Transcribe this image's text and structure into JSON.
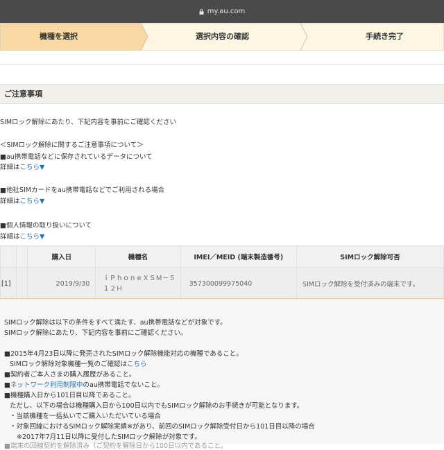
{
  "browser": {
    "url": "my.au.com"
  },
  "steps": {
    "items": [
      {
        "label": "機種を選択",
        "active": true
      },
      {
        "label": "選択内容の確認",
        "active": false
      },
      {
        "label": "手続き完了",
        "active": false
      }
    ],
    "colors": {
      "active": "#f9d9a3",
      "inactive": "#fdf6e3",
      "border": "#cfc8b0"
    }
  },
  "notice": {
    "title": "ご注意事項",
    "intro": "SIMロック解除にあたり、下記内容を事前にご確認ください",
    "section_heading": "＜SIMロック解除に関するご注意事項について＞",
    "items": [
      {
        "label": "■au携帯電話などに保存されているデータについて",
        "detail_prefix": "詳細は",
        "detail_link": "こちら▼"
      },
      {
        "label": "■他社SIMカードをau携帯電話などでご利用される場合",
        "detail_prefix": "詳細は",
        "detail_link": "こちら▼"
      },
      {
        "label": "■個人情報の取り扱いについて",
        "detail_prefix": "詳細は",
        "detail_link": "こちら▼"
      }
    ]
  },
  "device_table": {
    "headers": [
      "",
      "",
      "購入日",
      "機種名",
      "IMEI／MEID (端末製造番号)",
      "SIMロック解除可否"
    ],
    "rows": [
      {
        "index": "[1]",
        "check": "",
        "purchase_date": "2019/9/30",
        "model_line1": "ｉＰｈｏｎｅＸＳＭ－５",
        "model_line2": "１２Ｈ",
        "imei": "357300099975040",
        "status": "SIMロック解除を受付済みの端末です。"
      }
    ]
  },
  "conditions": {
    "line1": "SIMロック解除は以下の条件をすべて満たす、au携帯電話などが対象です。",
    "line2": "SIMロック解除にあたり、下記内容を事前にご確認ください。",
    "c1": "■2015年4月23日以降に発売されたSIMロック解除機能対応の機種であること。",
    "c1_sub_prefix": "SIMロック解除対象機種一覧のご確認は",
    "c1_sub_link": "こちら",
    "c2": "■契約者ご本人さまの購入履歴があること。",
    "c3_prefix": "■",
    "c3_link": "ネットワーク利用制限中",
    "c3_suffix": "のau携帯電話でないこと。",
    "c4": "■機種購入日から101日目以降であること。",
    "c4_sub": "ただし、以下の場合は機種購入日から100日以内でもSIMロック解除のお手続きが可能となります。",
    "c4_b1": "・当該機種を一括払いでご購入いただいている場合",
    "c4_b2": "・対象回線におけるSIMロック解除実績※があり、前回のSIMロック解除受付日から101日目以降の場合",
    "c4_b2_note": "※2017年7月11日以降に受付したSIMロック解除が対象です。",
    "c5_partial": "■端末の回線契約を解除済み（ご契約を解除日から100日以内であること。"
  }
}
